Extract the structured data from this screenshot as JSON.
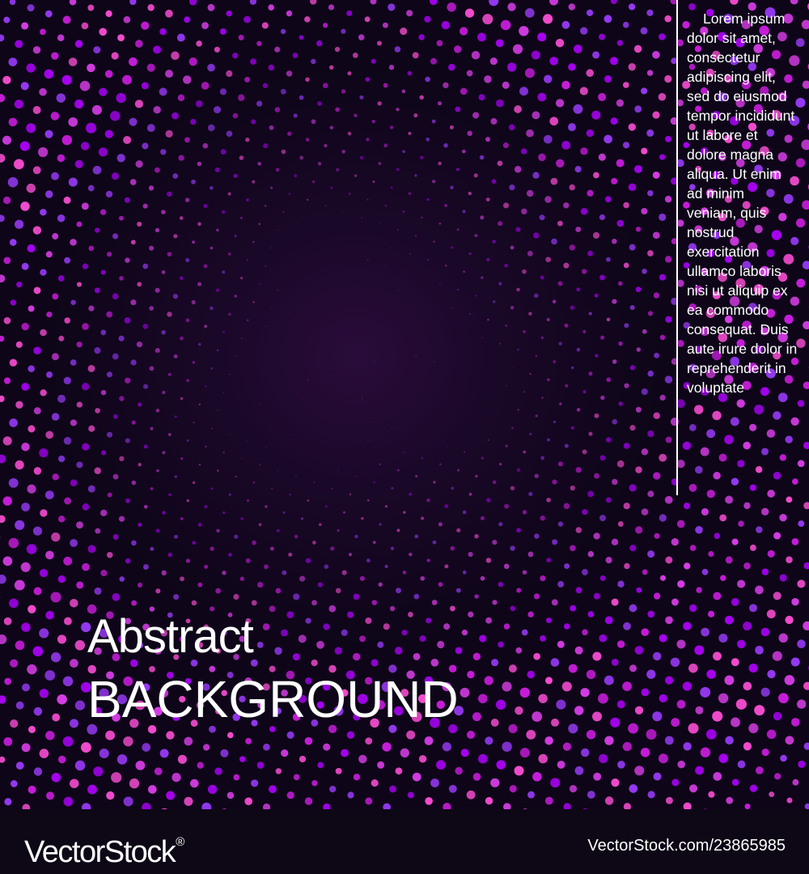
{
  "artwork": {
    "background_color": "#12061e",
    "dot_colors": [
      "#b000ff",
      "#d21ee6",
      "#e040f0",
      "#9d3cff",
      "#ff4fd8"
    ],
    "sidebar_text": "Lorem ipsum dolor sit amet, consectetur adipiscing elit, sed do eiusmod tempor incididunt ut labore et dolore magna aliqua. Ut enim ad minim veniam, quis nostrud exercitation ullamco laboris nisi ut aliquip ex ea commodo consequat. Duis aute irure dolor in reprehenderit in voluptate",
    "title_line1": "Abstract",
    "title_line2": "BACKGROUND"
  },
  "watermark": {
    "brand": "VectorStock",
    "registered_mark": "®",
    "image_id": "VectorStock.com/23865985",
    "background_color": "#0d0716"
  }
}
